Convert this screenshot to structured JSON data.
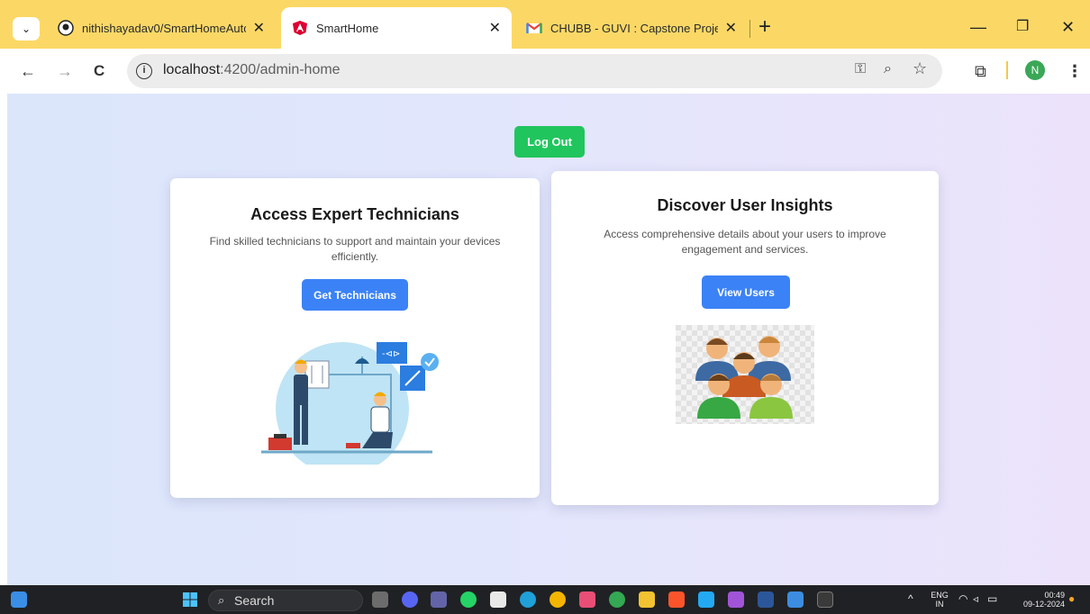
{
  "browser": {
    "tabs": [
      {
        "title": "nithishayadav0/SmartHomeAutom",
        "icon": "github-icon"
      },
      {
        "title": "SmartHome",
        "icon": "angular-icon",
        "active": true
      },
      {
        "title": "CHUBB - GUVI : Capstone Project",
        "icon": "gmail-icon"
      }
    ],
    "url_host": "localhost",
    "url_path": ":4200/admin-home",
    "profile_initial": "N"
  },
  "page": {
    "logout_label": "Log Out",
    "technicians": {
      "title": "Access Expert Technicians",
      "description": "Find skilled technicians to support and maintain your devices efficiently.",
      "button": "Get Technicians"
    },
    "users": {
      "title": "Discover User Insights",
      "description": "Access comprehensive details about your users to improve engagement and services.",
      "button": "View Users"
    }
  },
  "taskbar": {
    "search_label": "Search",
    "lang_primary": "ENG",
    "lang_secondary": "IN",
    "time": "00:49",
    "date": "09-12-2024"
  },
  "colors": {
    "tabstrip": "#fbd866",
    "logout": "#21c55d",
    "primary_button": "#3b82f6"
  }
}
